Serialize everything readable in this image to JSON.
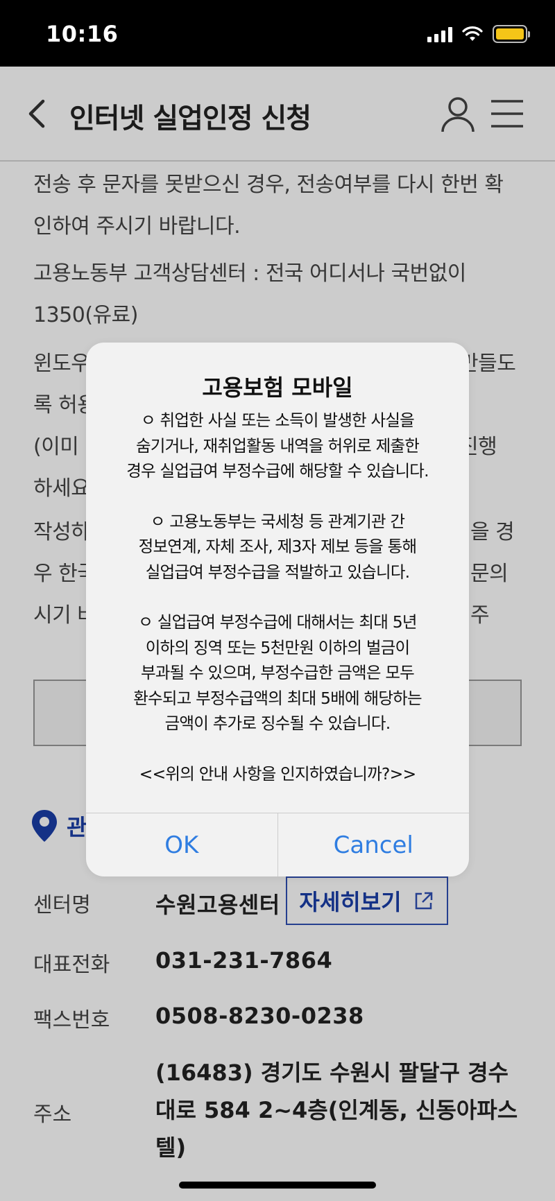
{
  "status_bar": {
    "time": "10:16"
  },
  "header": {
    "title": "인터넷 실업인정 신청"
  },
  "content": {
    "p1": [
      "전송 후 문자를 못받으신 경우, 전송여부를 다시 한번 확",
      "인하여 주시기 바랍니다."
    ],
    "p2": [
      "고용노동부 고객상담센터 : 전국 어디서나 국번없이",
      "1350(유료)"
    ],
    "p3": [
      "윈도우",
      "록 허용",
      "(이미",
      "하세요"
    ],
    "p3_right": [
      "만들도",
      "",
      "진행",
      ""
    ],
    "p4": [
      "작성하",
      "우 한국",
      "시기 바"
    ],
    "p4_right": [
      "을 경",
      "문의주",
      ""
    ]
  },
  "center": {
    "heading": "관",
    "name_label": "센터명",
    "name_value": "수원고용센터",
    "detail_button": "자세히보기",
    "phone_label": "대표전화",
    "phone_value": "031-231-7864",
    "fax_label": "팩스번호",
    "fax_value": "0508-8230-0238",
    "address_label": "주소",
    "address_lines": [
      "(16483) 경기도 수원시 팔달구 경수",
      "대로 584 2~4층(인계동, 신동아파스",
      "텔)"
    ]
  },
  "dialog": {
    "title": "고용보험 모바일",
    "block1": [
      "ㅇ 취업한 사실 또는 소득이 발생한 사실을",
      "숨기거나, 재취업활동 내역을 허위로 제출한",
      "경우 실업급여 부정수급에 해당할 수 있습니다."
    ],
    "block2": [
      "ㅇ 고용노동부는 국세청 등 관계기관 간",
      "정보연계, 자체 조사, 제3자 제보 등을 통해",
      "실업급여 부정수급을 적발하고 있습니다."
    ],
    "block3": [
      "ㅇ 실업급여 부정수급에 대해서는 최대 5년",
      "이하의 징역 또는 5천만원 이하의 벌금이",
      "부과될 수 있으며, 부정수급한 금액은 모두",
      "환수되고 부정수급액의 최대 5배에 해당하는",
      "금액이 추가로 징수될 수 있습니다."
    ],
    "question": "<<위의 안내 사항을 인지하였습니까?>>",
    "ok_label": "OK",
    "cancel_label": "Cancel"
  },
  "colors": {
    "accent_blue": "#1a3ea8",
    "ios_blue": "#2f7de1",
    "battery_yellow": "#f5c518"
  }
}
